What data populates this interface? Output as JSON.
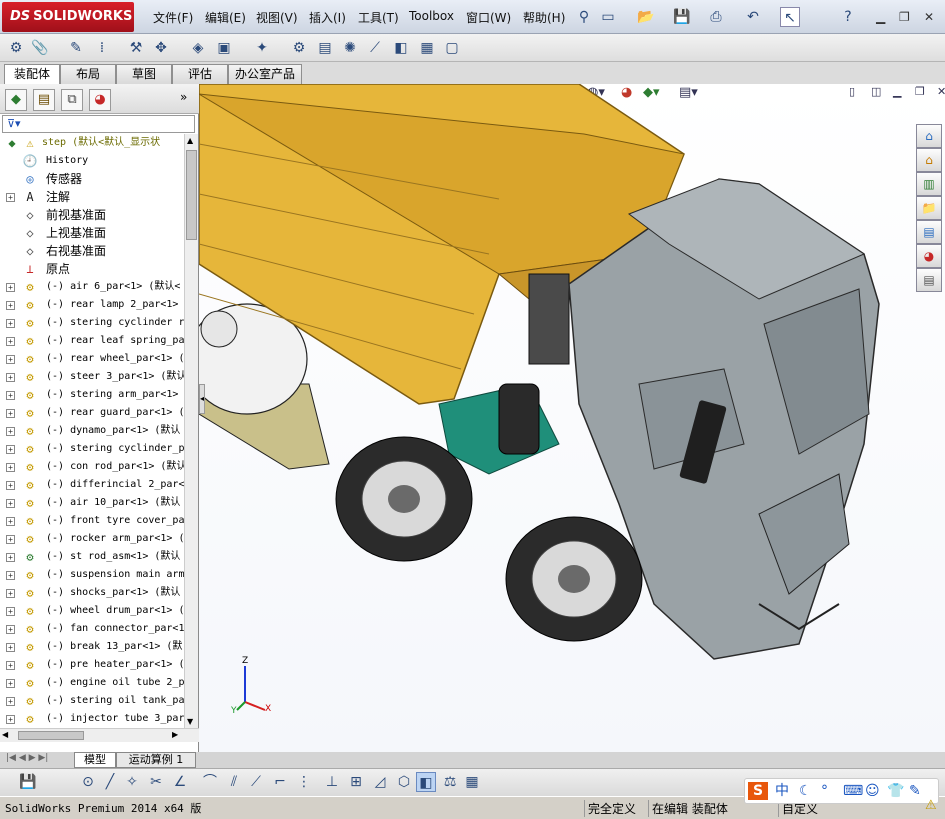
{
  "app": {
    "logo_text": "SOLIDWORKS",
    "logo_ds": "DS",
    "brand_color": "#c8161f"
  },
  "menu": [
    {
      "label": "文件(F)"
    },
    {
      "label": "编辑(E)"
    },
    {
      "label": "视图(V)"
    },
    {
      "label": "插入(I)"
    },
    {
      "label": "工具(T)"
    },
    {
      "label": "Toolbox"
    },
    {
      "label": "窗口(W)"
    },
    {
      "label": "帮助(H)"
    }
  ],
  "command_tabs": [
    {
      "label": "装配体",
      "active": true
    },
    {
      "label": "布局"
    },
    {
      "label": "草图"
    },
    {
      "label": "评估"
    },
    {
      "label": "办公室产品"
    }
  ],
  "feature_tree": {
    "root": "step  (默认<默认_显示状",
    "items": [
      {
        "label": "History",
        "icon": "history-icon",
        "type": "folder"
      },
      {
        "label": "传感器",
        "icon": "sensor-icon",
        "type": "folder",
        "cn": true
      },
      {
        "label": "注解",
        "icon": "annotation-icon",
        "type": "folder",
        "cn": true,
        "expandable": true
      },
      {
        "label": "前视基准面",
        "icon": "plane-icon",
        "type": "plane",
        "cn": true
      },
      {
        "label": "上视基准面",
        "icon": "plane-icon",
        "type": "plane",
        "cn": true
      },
      {
        "label": "右视基准面",
        "icon": "plane-icon",
        "type": "plane",
        "cn": true
      },
      {
        "label": "原点",
        "icon": "origin-icon",
        "type": "origin",
        "cn": true
      },
      {
        "label": "(-) air 6_par<1> (默认<",
        "icon": "part-icon",
        "expandable": true
      },
      {
        "label": "(-) rear lamp 2_par<1>",
        "icon": "part-icon",
        "expandable": true
      },
      {
        "label": "(-) stering cyclinder r",
        "icon": "part-icon",
        "expandable": true
      },
      {
        "label": "(-) rear leaf spring_pa",
        "icon": "part-icon",
        "expandable": true
      },
      {
        "label": "(-) rear wheel_par<1> (",
        "icon": "part-icon",
        "expandable": true
      },
      {
        "label": "(-) steer 3_par<1> (默认",
        "icon": "part-icon",
        "expandable": true
      },
      {
        "label": "(-) stering arm_par<1>",
        "icon": "part-icon",
        "expandable": true
      },
      {
        "label": "(-) rear guard_par<1> (",
        "icon": "part-icon",
        "expandable": true
      },
      {
        "label": "(-) dynamo_par<1> (默认",
        "icon": "part-icon",
        "expandable": true
      },
      {
        "label": "(-) stering cyclinder_p",
        "icon": "part-icon",
        "expandable": true
      },
      {
        "label": "(-) con rod_par<1> (默认",
        "icon": "part-icon",
        "expandable": true
      },
      {
        "label": "(-) differincial 2_par<",
        "icon": "part-icon",
        "expandable": true
      },
      {
        "label": "(-) air 10_par<1> (默认",
        "icon": "part-icon",
        "expandable": true
      },
      {
        "label": "(-) front tyre cover_pa",
        "icon": "part-icon",
        "expandable": true
      },
      {
        "label": "(-) rocker arm_par<1> (",
        "icon": "part-icon",
        "expandable": true
      },
      {
        "label": "(-) st rod_asm<1> (默认",
        "icon": "assembly-icon",
        "expandable": true
      },
      {
        "label": "(-) suspension main arm",
        "icon": "part-icon",
        "expandable": true
      },
      {
        "label": "(-) shocks_par<1> (默认",
        "icon": "part-icon",
        "expandable": true
      },
      {
        "label": "(-) wheel drum_par<1> (",
        "icon": "part-icon",
        "expandable": true
      },
      {
        "label": "(-) fan connector_par<1",
        "icon": "part-icon",
        "expandable": true
      },
      {
        "label": "(-) break 13_par<1> (默",
        "icon": "part-icon",
        "expandable": true
      },
      {
        "label": "(-) pre heater_par<1> (",
        "icon": "part-icon",
        "expandable": true
      },
      {
        "label": "(-) engine oil tube 2_p",
        "icon": "part-icon",
        "expandable": true
      },
      {
        "label": "(-) stering oil tank_pa",
        "icon": "part-icon",
        "expandable": true
      },
      {
        "label": "(-) injector tube 3_par",
        "icon": "part-icon",
        "expandable": true
      }
    ]
  },
  "bottom_tabs": [
    {
      "label": "模型",
      "active": true
    },
    {
      "label": "运动算例 1"
    }
  ],
  "status": {
    "product": "SolidWorks Premium 2014 x64 版",
    "state1": "完全定义",
    "state2": "在编辑 装配体",
    "units": "自定义"
  },
  "triad": {
    "x": "X",
    "y": "Y",
    "z": "Z"
  },
  "ime": {
    "label": "中"
  },
  "colors": {
    "truck_bed": "#e6b63a",
    "cab": "#9aa2a6",
    "chassis_teal": "#1f8f7a",
    "tyre": "#2b2b2b"
  }
}
